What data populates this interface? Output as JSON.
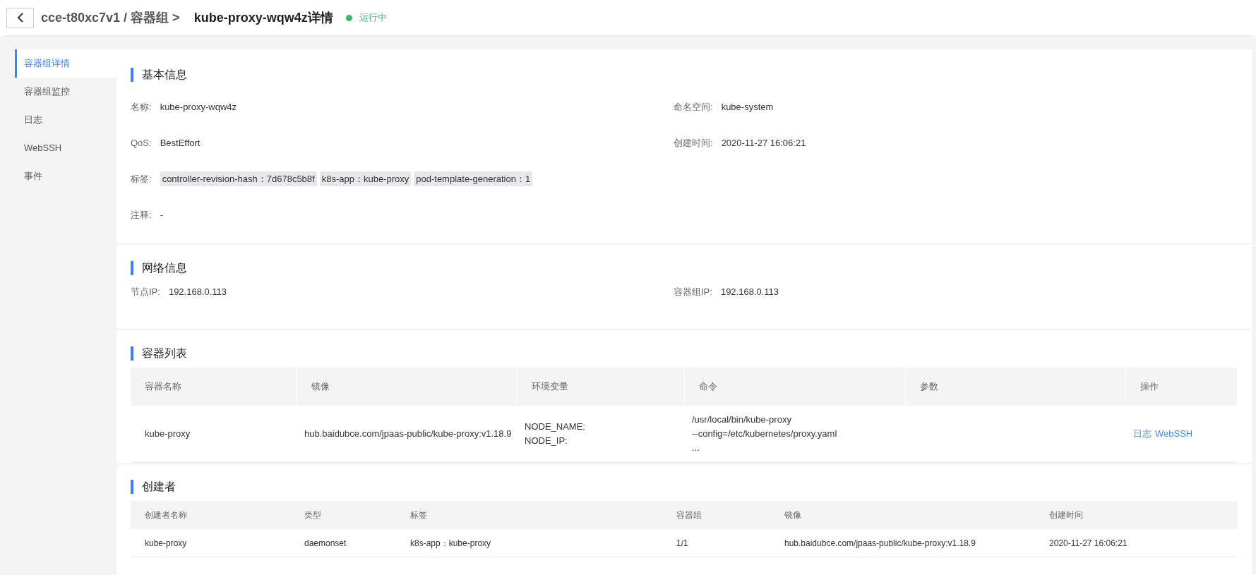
{
  "header": {
    "breadcrumb": "cce-t80xc7v1 / 容器组 >",
    "title": "kube-proxy-wqw4z详情",
    "status": {
      "label": "运行中",
      "color": "#2fbd6b"
    }
  },
  "sidebar": {
    "items": [
      {
        "label": "容器组详情",
        "selected": true
      },
      {
        "label": "容器组监控",
        "selected": false
      },
      {
        "label": "日志",
        "selected": false
      },
      {
        "label": "WebSSH",
        "selected": false
      },
      {
        "label": "事件",
        "selected": false
      }
    ]
  },
  "basic_info": {
    "title": "基本信息",
    "fields": [
      {
        "label": "名称:",
        "value": "kube-proxy-wqw4z"
      },
      {
        "label": "命名空间:",
        "value": "kube-system"
      },
      {
        "label": "QoS:",
        "value": "BestEffort"
      },
      {
        "label": "创建时间:",
        "value": "2020-11-27 16:06:21"
      }
    ],
    "tags_label": "标签:",
    "tags": [
      "controller-revision-hash：7d678c5b8f",
      "k8s-app：kube-proxy",
      "pod-template-generation：1"
    ],
    "note_label": "注释:",
    "note": "-"
  },
  "network_info": {
    "title": "网络信息",
    "fields": [
      {
        "label": "节点IP:",
        "value": "192.168.0.113"
      },
      {
        "label": "容器组IP:",
        "value": "192.168.0.113"
      }
    ]
  },
  "containers": {
    "title": "容器列表",
    "columns": [
      "容器名称",
      "镜像",
      "环境变量",
      "命令",
      "参数",
      "操作"
    ],
    "rows": [
      {
        "name": "kube-proxy",
        "image": "hub.baidubce.com/jpaas-public/kube-proxy:v1.18.9",
        "env": [
          "NODE_NAME:",
          "NODE_IP:"
        ],
        "command": [
          "/usr/local/bin/kube-proxy",
          "--config=/etc/kubernetes/proxy.yaml",
          "..."
        ],
        "actions": [
          "日志",
          "WebSSH"
        ]
      }
    ]
  },
  "creator": {
    "title": "创建者",
    "columns": [
      "创建者名称",
      "类型",
      "标签",
      "容器组",
      "镜像",
      "创建时间"
    ],
    "rows": [
      [
        "kube-proxy",
        "daemonset",
        "k8s-app：kube-proxy",
        "1/1",
        "hub.baidubce.com/jpaas-public/kube-proxy:v1.18.9",
        "2020-11-27 16:06:21"
      ]
    ]
  }
}
